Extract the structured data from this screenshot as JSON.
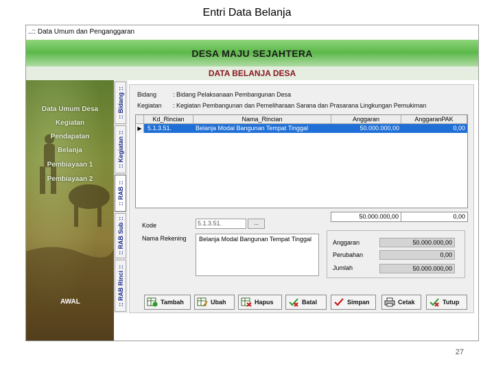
{
  "slide": {
    "title": "Entri Data Belanja",
    "page_number": "27"
  },
  "window": {
    "title": "..:: Data Umum dan Penganggaran",
    "banner_title": "DESA MAJU SEJAHTERA",
    "subtitle": "DATA BELANJA DESA"
  },
  "sidebar": {
    "items": [
      "Data Umum Desa",
      "Kegiatan",
      "Pendapatan",
      "Belanja",
      "Pembiayaan 1",
      "Pembiayaan 2"
    ],
    "awal": "AWAL"
  },
  "tabs": [
    ":: Bidang ::",
    ":: Kegiatan ::",
    ":: RAB ::",
    ":: RAB Sub ::",
    ":: RAB Rinci ::"
  ],
  "header_info": {
    "bidang_label": "Bidang",
    "bidang_value": ": Bidang Pelaksanaan Pembangunan Desa",
    "kegiatan_label": "Kegiatan",
    "kegiatan_value": ": Kegiatan Pembangunan dan Pemeliharaan Sarana dan Prasarana Lingkungan Pemukiman"
  },
  "grid": {
    "columns": [
      "Kd_Rincian",
      "Nama_Rincian",
      "Anggaran",
      "AnggaranPAK"
    ],
    "rows": [
      {
        "kd": "5.1.3.51.",
        "nama": "Belanja Modal Bangunan Tempat Tinggal",
        "anggaran": "50.000.000,00",
        "pak": "0,00"
      }
    ],
    "row_indicator": "▶",
    "total_anggaran": "50.000.000,00",
    "total_pak": "0,00"
  },
  "form": {
    "kode_label": "Kode",
    "kode_value": "5.1.3.51.",
    "kode_button": "...",
    "nama_label": "Nama Rekening",
    "nama_value": "Belanja Modal Bangunan Tempat Tinggal"
  },
  "summary": {
    "anggaran_label": "Anggaran",
    "anggaran_value": "50.000.000,00",
    "perubahan_label": "Perubahan",
    "perubahan_value": "0,00",
    "jumlah_label": "Jumlah",
    "jumlah_value": "50.000.000,00"
  },
  "toolbar": {
    "tambah": "Tambah",
    "ubah": "Ubah",
    "hapus": "Hapus",
    "batal": "Batal",
    "simpan": "Simpan",
    "cetak": "Cetak",
    "tutup": "Tutup"
  },
  "colors": {
    "banner_green": "#5cb84a",
    "subtitle_red": "#8a1522",
    "selection_blue": "#1f6fd6",
    "tab_text_blue": "#1a2a8a"
  },
  "icons": [
    "grid-add-icon",
    "grid-edit-icon",
    "grid-delete-icon",
    "cancel-check-icon",
    "save-check-icon",
    "printer-icon",
    "exit-check-icon"
  ]
}
